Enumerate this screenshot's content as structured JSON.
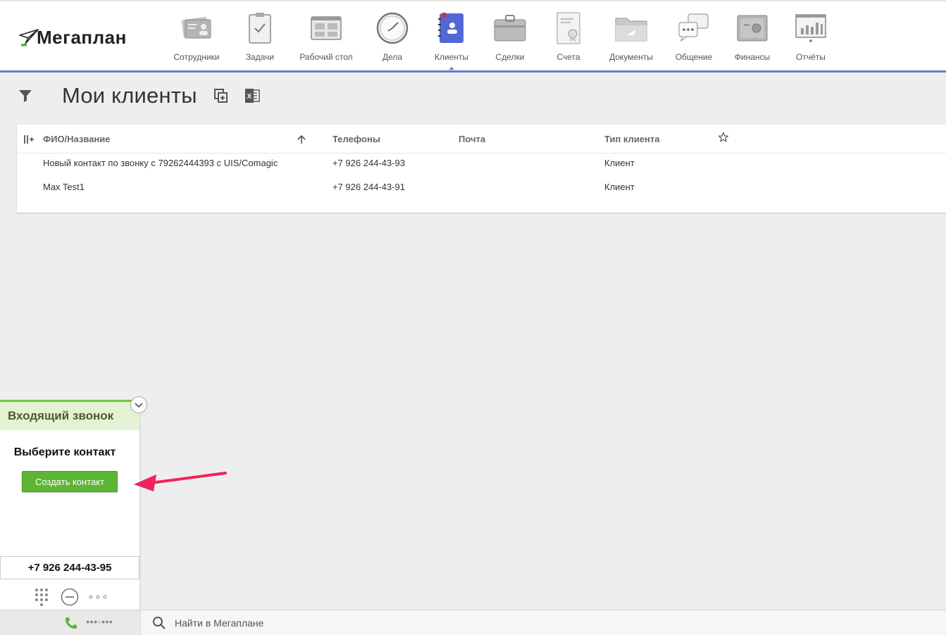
{
  "app": {
    "logo_text": "Мегаплан"
  },
  "nav": {
    "items": [
      {
        "label": "Сотрудники",
        "icon": "employees-icon"
      },
      {
        "label": "Задачи",
        "icon": "tasks-icon"
      },
      {
        "label": "Рабочий стол",
        "icon": "desktop-icon"
      },
      {
        "label": "Дела",
        "icon": "clock-icon"
      },
      {
        "label": "Клиенты",
        "icon": "clients-icon",
        "active": true
      },
      {
        "label": "Сделки",
        "icon": "briefcase-icon"
      },
      {
        "label": "Счета",
        "icon": "invoice-icon"
      },
      {
        "label": "Документы",
        "icon": "documents-icon"
      },
      {
        "label": "Общение",
        "icon": "chat-icon"
      },
      {
        "label": "Финансы",
        "icon": "safe-icon"
      },
      {
        "label": "Отчёты",
        "icon": "reports-icon"
      }
    ]
  },
  "page": {
    "title": "Мои клиенты"
  },
  "table": {
    "columns": [
      "ФИО/Название",
      "Телефоны",
      "Почта",
      "Тип клиента"
    ],
    "rows": [
      {
        "name": "Новый контакт по звонку с 79262444393 с UIS/Comagic",
        "phone": "+7 926 244-43-93",
        "email": "",
        "type": "Клиент"
      },
      {
        "name": "Max Test1",
        "phone": "+7 926 244-43-91",
        "email": "",
        "type": "Клиент"
      }
    ]
  },
  "call_widget": {
    "title": "Входящий звонок",
    "subtitle": "Выберите контакт",
    "create_button": "Создать контакт",
    "phone": "+7 926 244-43-95",
    "bottom_status": "●●●○●●●"
  },
  "search": {
    "placeholder": "Найти в Мегаплане"
  },
  "colors": {
    "accent": "#6a78d1",
    "green": "#5db534",
    "widget_header": "#e3f3d4",
    "arrow": "#f0245a"
  }
}
